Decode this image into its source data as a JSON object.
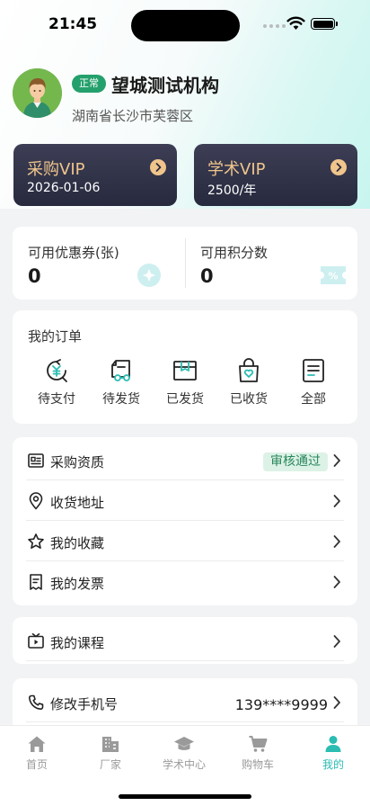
{
  "status_bar": {
    "time": "21:45"
  },
  "profile": {
    "status_badge": "正常",
    "org_name": "望城测试机构",
    "location": "湖南省长沙市芙蓉区"
  },
  "vip": [
    {
      "title": "采购VIP",
      "sub": "2026-01-06"
    },
    {
      "title": "学术VIP",
      "sub": "2500/年"
    }
  ],
  "points": {
    "coupons_label": "可用优惠券(张)",
    "coupons_value": "0",
    "coupon_icon": "coupon-icon",
    "score_label": "可用积分数",
    "score_value": "0",
    "score_icon": "ticket-icon"
  },
  "orders": {
    "title": "我的订单",
    "items": [
      {
        "label": "待支付",
        "icon": "pending-payment-icon"
      },
      {
        "label": "待发货",
        "icon": "pending-shipment-icon"
      },
      {
        "label": "已发货",
        "icon": "shipped-icon"
      },
      {
        "label": "已收货",
        "icon": "received-icon"
      },
      {
        "label": "全部",
        "icon": "all-orders-icon"
      }
    ]
  },
  "menu": {
    "qualification": {
      "label": "采购资质",
      "badge": "审核通过",
      "icon": "certificate-icon"
    },
    "address": {
      "label": "收货地址",
      "icon": "location-pin-icon"
    },
    "favorites": {
      "label": "我的收藏",
      "icon": "star-icon"
    },
    "invoice": {
      "label": "我的发票",
      "icon": "invoice-icon"
    },
    "courses": {
      "label": "我的课程",
      "icon": "video-icon"
    },
    "phone": {
      "label": "修改手机号",
      "value": "139****9999",
      "icon": "phone-icon"
    }
  },
  "tabs": [
    {
      "label": "首页",
      "icon": "home-icon",
      "active": false
    },
    {
      "label": "厂家",
      "icon": "building-icon",
      "active": false
    },
    {
      "label": "学术中心",
      "icon": "graduation-cap-icon",
      "active": false
    },
    {
      "label": "购物车",
      "icon": "cart-icon",
      "active": false
    },
    {
      "label": "我的",
      "icon": "person-icon",
      "active": true
    }
  ],
  "colors": {
    "accent": "#2bbcb2",
    "vip_gold": "#f0c58c",
    "status_green": "#24a06c",
    "vip_card": "#2e3045"
  }
}
